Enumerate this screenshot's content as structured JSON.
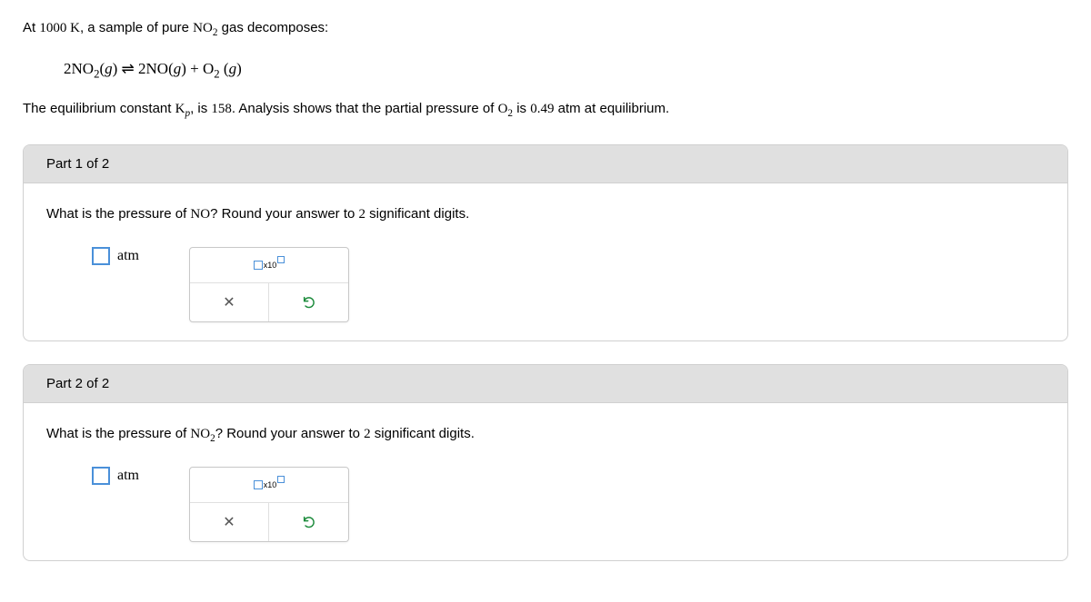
{
  "problem": {
    "intro_pre": "At ",
    "temp": "1000 K",
    "intro_mid": ", a sample of pure ",
    "compound": "NO",
    "compound_sub": "2",
    "intro_post": " gas decomposes:",
    "equation": "2NO₂(g) ⇌ 2NO(g) + O₂(g)",
    "constant_pre": "The equilibrium constant ",
    "constant_sym": "K",
    "constant_sub": "p",
    "constant_mid": ", is ",
    "constant_val": "158",
    "constant_mid2": ". Analysis shows that the partial pressure of ",
    "o2": "O",
    "o2_sub": "2",
    "constant_mid3": " is ",
    "pressure": "0.49",
    "constant_post": " atm at equilibrium."
  },
  "parts": [
    {
      "header": "Part 1 of 2",
      "question_pre": "What is the pressure of ",
      "question_compound": "NO",
      "question_compound_sub": "",
      "question_post": "? Round your answer to ",
      "sigfigs": "2",
      "question_end": " significant digits.",
      "unit": "atm",
      "sci_label": "x10"
    },
    {
      "header": "Part 2 of 2",
      "question_pre": "What is the pressure of ",
      "question_compound": "NO",
      "question_compound_sub": "2",
      "question_post": "? Round your answer to ",
      "sigfigs": "2",
      "question_end": " significant digits.",
      "unit": "atm",
      "sci_label": "x10"
    }
  ]
}
